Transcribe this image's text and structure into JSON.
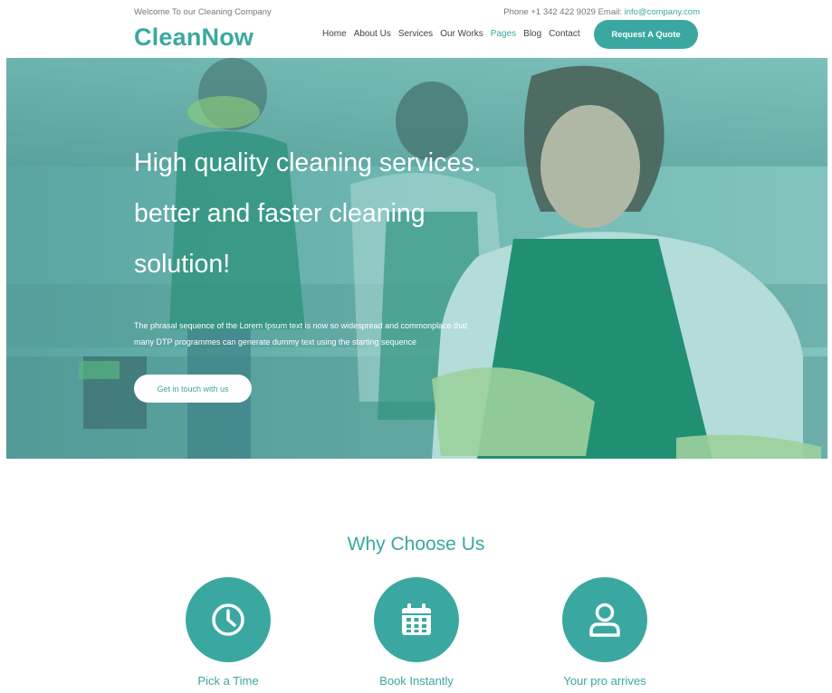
{
  "topbar": {
    "welcome": "Welcome To our Cleaning Company",
    "contact_prefix": "Phone +1 342 422 9029 Email: ",
    "email": "info@company.com"
  },
  "header": {
    "logo": "CleanNow",
    "nav": [
      "Home",
      "About Us",
      "Services",
      "Our Works",
      "Pages",
      "Blog",
      "Contact"
    ],
    "active_nav": "Pages",
    "cta": "Request A Quote"
  },
  "hero": {
    "title_lines": [
      "High quality cleaning services.",
      "better and faster cleaning",
      "solution!"
    ],
    "text": "The phrasal sequence of the Lorem Ipsum text is now so widespread and commonplace that many DTP programmes can generate dummy text using the starting sequence",
    "button": "Get in touch with us"
  },
  "why": {
    "title": "Why Choose Us",
    "items": [
      {
        "label": "Pick a Time",
        "icon": "clock-icon"
      },
      {
        "label": "Book Instantly",
        "icon": "calendar-icon"
      },
      {
        "label": "Your pro arrives",
        "icon": "user-icon"
      }
    ]
  },
  "colors": {
    "accent": "#3aa8a0",
    "text": "#555555",
    "white": "#ffffff"
  }
}
